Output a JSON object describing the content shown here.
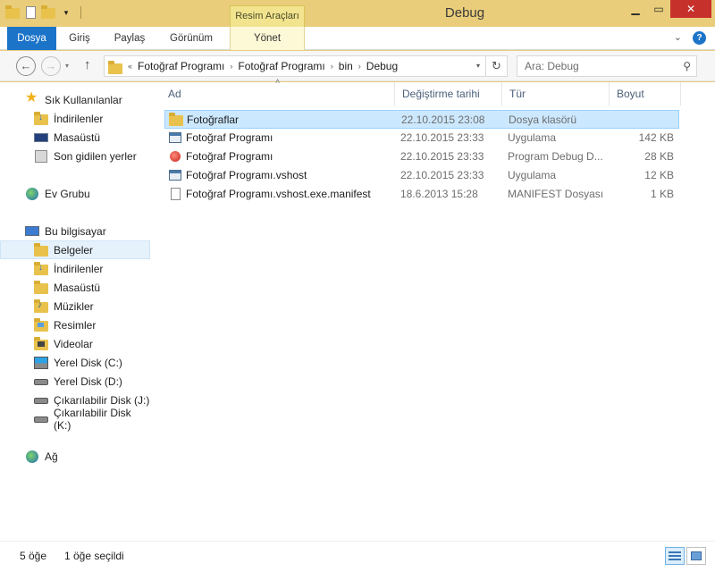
{
  "window": {
    "title": "Debug",
    "contextual_group": "Resim Araçları"
  },
  "ribbon": {
    "tabs": [
      "Dosya",
      "Giriş",
      "Paylaş",
      "Görünüm",
      "Yönet"
    ]
  },
  "address": {
    "overflow": "«",
    "crumbs": [
      "Fotoğraf Programı",
      "Fotoğraf Programı",
      "bin",
      "Debug"
    ],
    "search_placeholder": "Ara: Debug"
  },
  "nav": {
    "favorites_label": "Sık Kullanılanlar",
    "favorites": [
      "İndirilenler",
      "Masaüstü",
      "Son gidilen yerler"
    ],
    "homegroup_label": "Ev Grubu",
    "computer_label": "Bu bilgisayar",
    "computer": [
      "Belgeler",
      "İndirilenler",
      "Masaüstü",
      "Müzikler",
      "Resimler",
      "Videolar",
      "Yerel Disk (C:)",
      "Yerel Disk (D:)",
      "Çıkarılabilir Disk (J:)",
      "Çıkarılabilir Disk (K:)"
    ],
    "network_label": "Ağ",
    "selected": "Belgeler"
  },
  "columns": {
    "name": "Ad",
    "date": "Değiştirme tarihi",
    "type": "Tür",
    "size": "Boyut"
  },
  "files": [
    {
      "name": "Fotoğraflar",
      "date": "22.10.2015 23:08",
      "type": "Dosya klasörü",
      "size": "",
      "icon": "folder-icon",
      "selected": true
    },
    {
      "name": "Fotoğraf Programı",
      "date": "22.10.2015 23:33",
      "type": "Uygulama",
      "size": "142 KB",
      "icon": "application-icon",
      "selected": false
    },
    {
      "name": "Fotoğraf Programı",
      "date": "22.10.2015 23:33",
      "type": "Program Debug D...",
      "size": "28 KB",
      "icon": "debug-database-icon",
      "selected": false
    },
    {
      "name": "Fotoğraf Programı.vshost",
      "date": "22.10.2015 23:33",
      "type": "Uygulama",
      "size": "12 KB",
      "icon": "application-icon",
      "selected": false
    },
    {
      "name": "Fotoğraf Programı.vshost.exe.manifest",
      "date": "18.6.2013 15:28",
      "type": "MANIFEST Dosyası",
      "size": "1 KB",
      "icon": "file-icon",
      "selected": false
    }
  ],
  "status": {
    "item_count": "5 öğe",
    "selection": "1 öğe seçildi"
  },
  "colors": {
    "title_bar": "#e9cd7a",
    "file_tab": "#1c74c8",
    "selection": "#cce8ff",
    "close_button": "#c7312b"
  }
}
